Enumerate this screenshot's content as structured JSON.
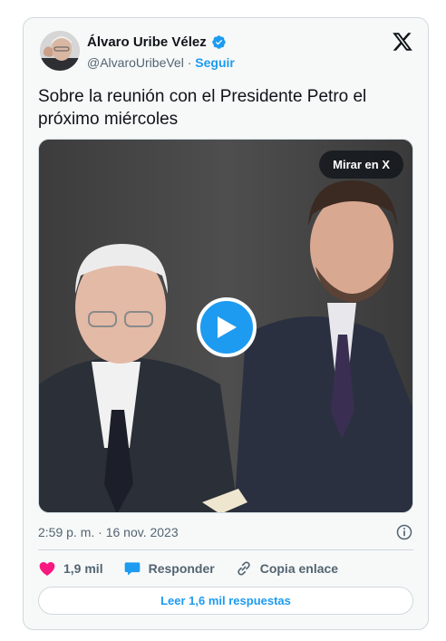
{
  "author": {
    "name": "Álvaro Uribe Vélez",
    "handle": "@AlvaroUribeVel",
    "separator": "·",
    "follow_label": "Seguir",
    "avatar_icon": "avatar",
    "verified_icon": "verified-badge-icon"
  },
  "brand": {
    "logo_icon": "x-logo-icon"
  },
  "tweet": {
    "text": "Sobre la reunión con el Presidente Petro el próximo miércoles",
    "timestamp": "2:59 p. m. · 16 nov. 2023"
  },
  "media": {
    "watch_label": "Mirar en X",
    "play_icon": "play-icon"
  },
  "actions": {
    "likes_count": "1,9 mil",
    "reply_label": "Responder",
    "copy_link_label": "Copia enlace"
  },
  "replies_button_label": "Leer 1,6 mil respuestas",
  "colors": {
    "accent": "#1d9bf0",
    "like": "#f91880",
    "card_bg": "#f7f9f9",
    "border": "#cfd9de",
    "muted_text": "#536471"
  }
}
